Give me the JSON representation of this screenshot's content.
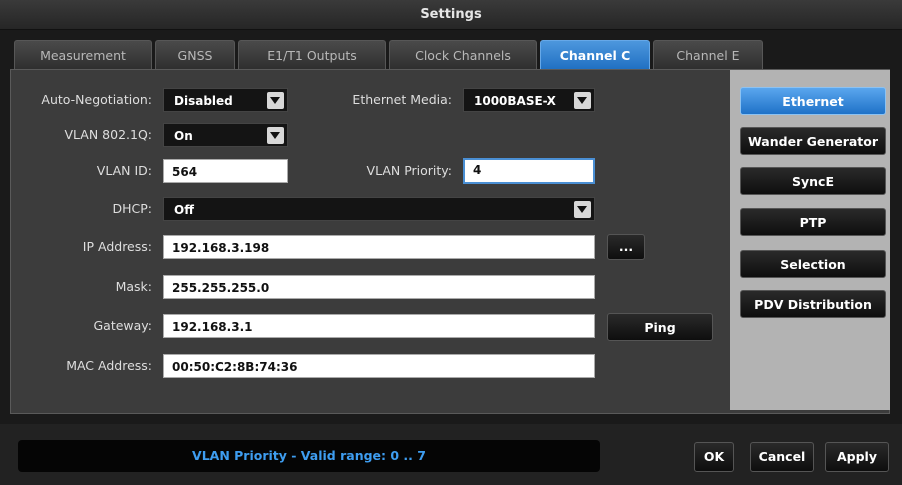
{
  "window": {
    "title": "Settings"
  },
  "tabs": [
    {
      "label": "Measurement"
    },
    {
      "label": "GNSS"
    },
    {
      "label": "E1/T1 Outputs"
    },
    {
      "label": "Clock Channels"
    },
    {
      "label": "Channel C",
      "active": true
    },
    {
      "label": "Channel E"
    }
  ],
  "form": {
    "auto_negotiation": {
      "label": "Auto-Negotiation:",
      "value": "Disabled"
    },
    "ethernet_media": {
      "label": "Ethernet Media:",
      "value": "1000BASE-X"
    },
    "vlan_8021q": {
      "label": "VLAN 802.1Q:",
      "value": "On"
    },
    "vlan_id": {
      "label": "VLAN ID:",
      "value": "564"
    },
    "vlan_priority": {
      "label": "VLAN Priority:",
      "value": "4"
    },
    "dhcp": {
      "label": "DHCP:",
      "value": "Off"
    },
    "ip_address": {
      "label": "IP Address:",
      "value": "192.168.3.198",
      "button": "..."
    },
    "mask": {
      "label": "Mask:",
      "value": "255.255.255.0"
    },
    "gateway": {
      "label": "Gateway:",
      "value": "192.168.3.1",
      "button": "Ping"
    },
    "mac_address": {
      "label": "MAC Address:",
      "value": "00:50:C2:8B:74:36"
    }
  },
  "side_menu": [
    {
      "label": "Ethernet",
      "active": true
    },
    {
      "label": "Wander Generator"
    },
    {
      "label": "SyncE"
    },
    {
      "label": "PTP"
    },
    {
      "label": "Selection"
    },
    {
      "label": "PDV Distribution"
    }
  ],
  "status": {
    "message": "VLAN Priority - Valid range: 0 .. 7"
  },
  "footer": {
    "ok": "OK",
    "cancel": "Cancel",
    "apply": "Apply"
  },
  "colors": {
    "accent": "#2a7fd4",
    "status_text": "#3e9df0"
  },
  "icons": {
    "dropdown": "chevron-down-icon"
  }
}
